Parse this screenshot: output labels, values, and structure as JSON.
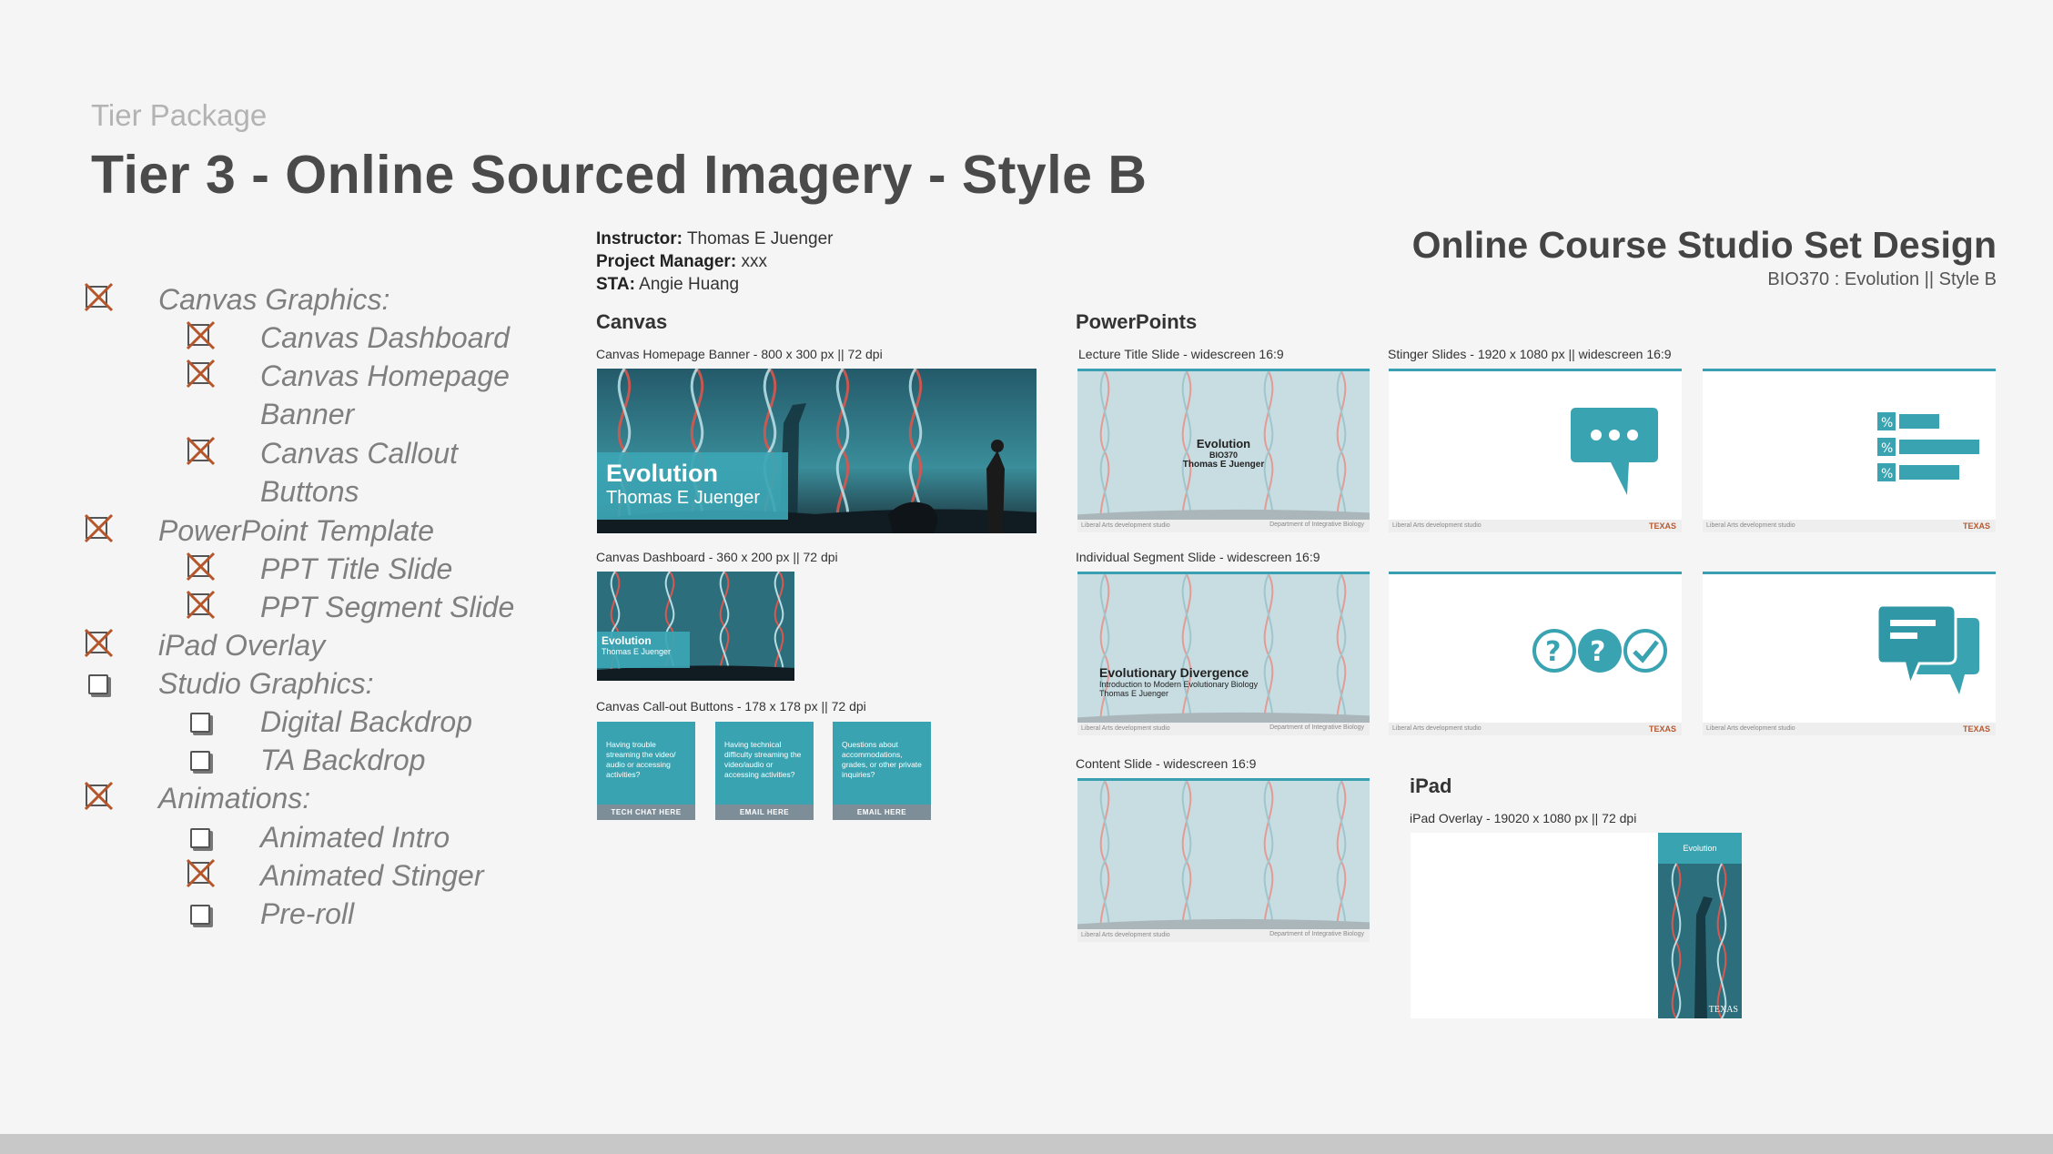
{
  "header": {
    "eyebrow": "Tier Package",
    "title": "Tier 3 - Online Sourced Imagery - Style B"
  },
  "checklist": [
    {
      "label": "Canvas Graphics:",
      "level": 0,
      "checked": true
    },
    {
      "label": "Canvas Dashboard",
      "level": 1,
      "checked": true
    },
    {
      "label": "Canvas Homepage",
      "label2": "Banner",
      "level": 1,
      "checked": true
    },
    {
      "label": "Canvas Callout",
      "label2": "Buttons",
      "level": 1,
      "checked": true
    },
    {
      "label": "PowerPoint Template",
      "level": 0,
      "checked": true
    },
    {
      "label": "PPT Title Slide",
      "level": 1,
      "checked": true
    },
    {
      "label": "PPT Segment Slide",
      "level": 1,
      "checked": true
    },
    {
      "label": "iPad Overlay",
      "level": 0,
      "checked": true
    },
    {
      "label": "Studio Graphics:",
      "level": 0,
      "checked": false
    },
    {
      "label": "Digital Backdrop",
      "level": 1,
      "checked": false
    },
    {
      "label": "TA Backdrop",
      "level": 1,
      "checked": false
    },
    {
      "label": "Animations:",
      "level": 0,
      "checked": true
    },
    {
      "label": "Animated Intro",
      "level": 1,
      "checked": false
    },
    {
      "label": "Animated Stinger",
      "level": 1,
      "checked": true
    },
    {
      "label": "Pre-roll",
      "level": 1,
      "checked": false
    }
  ],
  "meta": {
    "instructor_label": "Instructor:",
    "instructor": "Thomas E Juenger",
    "pm_label": "Project Manager:",
    "pm": "xxx",
    "sta_label": "STA:",
    "sta": "Angie Huang"
  },
  "deck": {
    "title": "Online Course Studio Set Design",
    "subtitle": "BIO370 : Evolution ||      Style B"
  },
  "canvas": {
    "heading": "Canvas",
    "banner_caption": "Canvas Homepage Banner - 800 x 300 px || 72 dpi",
    "banner_title": "Evolution",
    "banner_name": "Thomas E Juenger",
    "dashboard_caption": "Canvas Dashboard - 360 x 200 px || 72 dpi",
    "dashboard_title": "Evolution",
    "dashboard_name": "Thomas E Juenger",
    "buttons_caption": "Canvas Call-out Buttons - 178 x 178 px || 72 dpi",
    "buttons": [
      {
        "text": "Having trouble streaming the video/ audio or accessing activities?",
        "footer": "TECH CHAT HERE"
      },
      {
        "text": "Having technical difficulty streaming the video/audio or accessing activities?",
        "footer": "EMAIL HERE"
      },
      {
        "text": "Questions about accommodations, grades, or other private inquiries?",
        "footer": "EMAIL HERE"
      }
    ]
  },
  "powerpoints": {
    "heading": "PowerPoints",
    "lecture_caption": "Lecture Title Slide - widescreen 16:9",
    "lecture_title": "Evolution",
    "lecture_code": "BIO370",
    "lecture_name": "Thomas E Juenger",
    "stinger_caption": "Stinger Slides - 1920 x 1080 px || widescreen 16:9",
    "segment_caption": "Individual Segment Slide - widescreen 16:9",
    "segment_title": "Evolutionary Divergence",
    "segment_sub": "Introduction to Modern Evolutionary Biology",
    "segment_name": "Thomas E Juenger",
    "content_caption": "Content Slide - widescreen 16:9",
    "footer_left": "Liberal Arts development studio",
    "footer_mid": "Department of Integrative Biology",
    "footer_right": "TEXAS",
    "stinger_icons": [
      "chat-bubble-icon",
      "percent-list-icon",
      "question-check-icon",
      "message-stack-icon"
    ]
  },
  "ipad": {
    "heading": "iPad",
    "caption": "iPad Overlay - 19020 x 1080 px || 72 dpi",
    "title": "Evolution",
    "footer": "TEXAS"
  },
  "colors": {
    "accent": "#3aa3b1",
    "check": "#b5562a",
    "dark_teal": "#1f4e5c"
  }
}
